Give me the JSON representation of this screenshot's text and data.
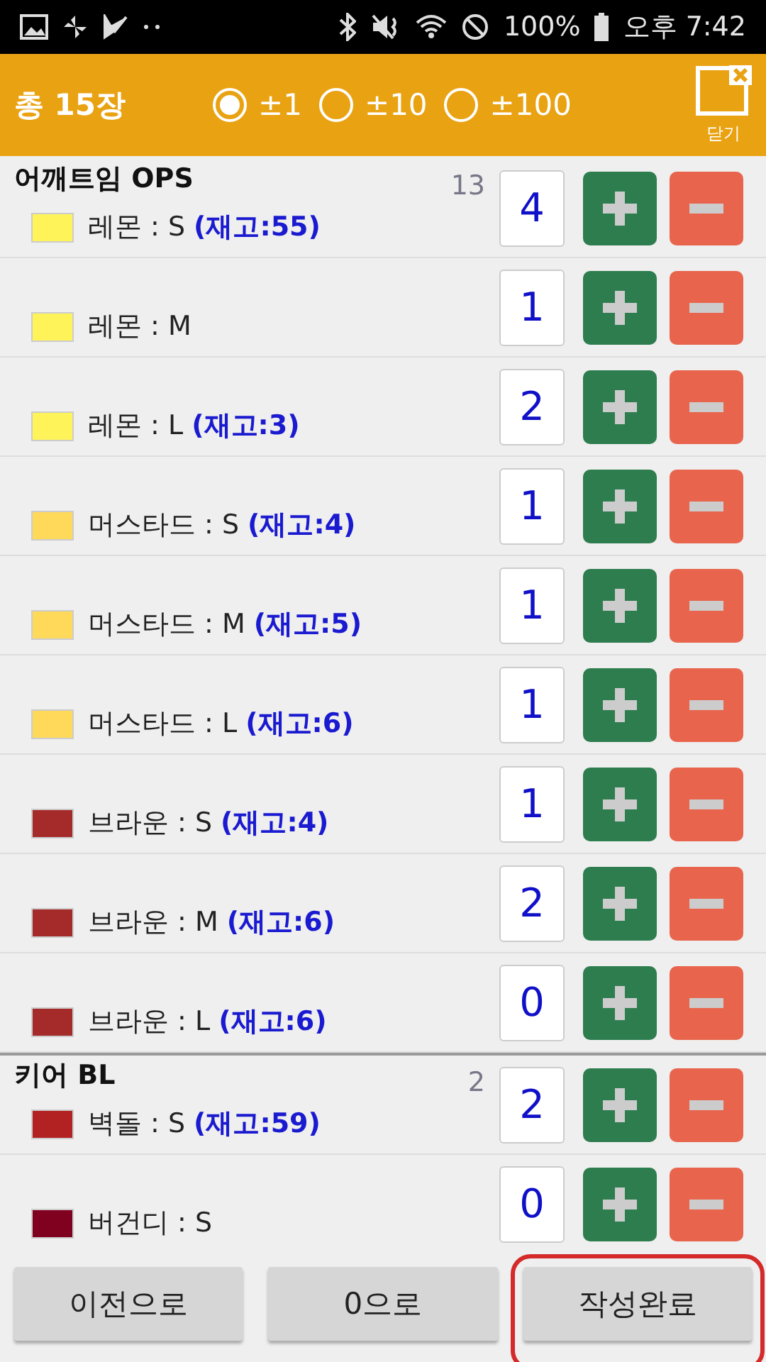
{
  "status_bar": {
    "battery": "100%",
    "time": "오후 7:42"
  },
  "header": {
    "total": "총 15장",
    "steps": [
      {
        "label": "±1",
        "selected": true
      },
      {
        "label": "±10",
        "selected": false
      },
      {
        "label": "±100",
        "selected": false
      }
    ],
    "close_label": "닫기"
  },
  "groups": [
    {
      "title": "어깨트임 OPS",
      "count": "13",
      "items": [
        {
          "name": "레몬 : S",
          "stock": "(재고:55)",
          "color": "#fff35a",
          "quantity": "4"
        },
        {
          "name": "레몬 : M",
          "color": "#fff35a",
          "quantity": "1"
        },
        {
          "name": "레몬 : L",
          "stock": "(재고:3)",
          "color": "#fff35a",
          "quantity": "2"
        },
        {
          "name": "머스타드 : S",
          "stock": "(재고:4)",
          "color": "#ffd95a",
          "quantity": "1"
        },
        {
          "name": "머스타드 : M",
          "stock": "(재고:5)",
          "color": "#ffd95a",
          "quantity": "1"
        },
        {
          "name": "머스타드 : L",
          "stock": "(재고:6)",
          "color": "#ffd95a",
          "quantity": "1"
        },
        {
          "name": "브라운 : S",
          "stock": "(재고:4)",
          "color": "#a52a2a",
          "quantity": "1"
        },
        {
          "name": "브라운 : M",
          "stock": "(재고:6)",
          "color": "#a52a2a",
          "quantity": "2"
        },
        {
          "name": "브라운 : L",
          "stock": "(재고:6)",
          "color": "#a52a2a",
          "quantity": "0"
        }
      ]
    },
    {
      "title": "키어 BL",
      "count": "2",
      "items": [
        {
          "name": "벽돌 : S",
          "stock": "(재고:59)",
          "color": "#b22222",
          "quantity": "2"
        },
        {
          "name": "버건디 : S",
          "color": "#800020",
          "quantity": "0"
        }
      ]
    }
  ],
  "buttons": [
    {
      "label": "이전으로",
      "highlighted": false
    },
    {
      "label": "0으로",
      "highlighted": false
    },
    {
      "label": "작성완료",
      "highlighted": true
    }
  ]
}
